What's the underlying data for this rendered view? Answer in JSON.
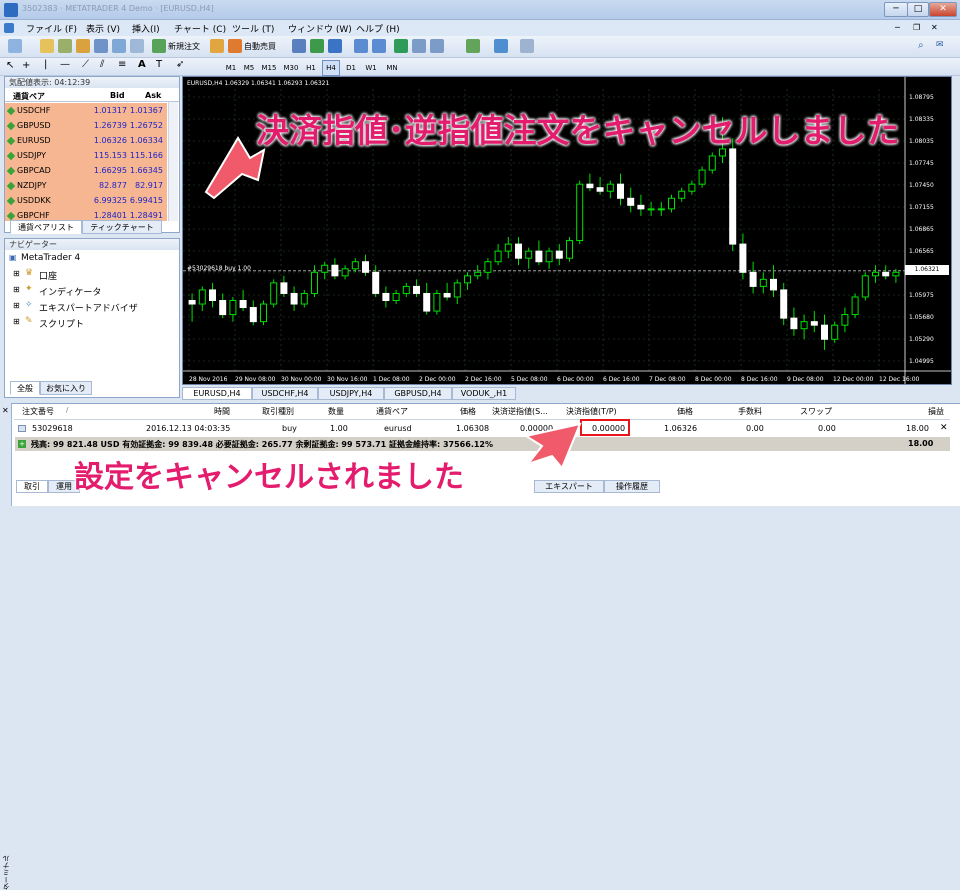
{
  "window": {
    "title": "3502383 · METATRADER 4 Demo · [EURUSD,H4]",
    "minimize": "─",
    "maximize": "□",
    "close": "✕"
  },
  "menu": [
    "ファイル (F)",
    "表示 (V)",
    "挿入(I)",
    "チャート (C)",
    "ツール (T)",
    "ウィンドウ (W)",
    "ヘルプ (H)"
  ],
  "toolbar": {
    "new_order": "新規注文",
    "auto_trade": "自動売買",
    "timeframes": [
      "M1",
      "M5",
      "M15",
      "M30",
      "H1",
      "H4",
      "D1",
      "W1",
      "MN"
    ],
    "active_tf": "H4"
  },
  "market_watch": {
    "title": "気配値表示: 04:12:39",
    "col_symbol": "通貨ペア",
    "col_bid": "Bid",
    "col_ask": "Ask",
    "rows": [
      {
        "symbol": "USDCHF",
        "bid": "1.01317",
        "ask": "1.01367"
      },
      {
        "symbol": "GBPUSD",
        "bid": "1.26739",
        "ask": "1.26752"
      },
      {
        "symbol": "EURUSD",
        "bid": "1.06326",
        "ask": "1.06334"
      },
      {
        "symbol": "USDJPY",
        "bid": "115.153",
        "ask": "115.166"
      },
      {
        "symbol": "GBPCAD",
        "bid": "1.66295",
        "ask": "1.66345"
      },
      {
        "symbol": "NZDJPY",
        "bid": "82.877",
        "ask": "82.917"
      },
      {
        "symbol": "USDDKK",
        "bid": "6.99325",
        "ask": "6.99415"
      },
      {
        "symbol": "GBPCHF",
        "bid": "1.28401",
        "ask": "1.28491"
      }
    ],
    "tabs": [
      "通貨ペアリスト",
      "ティックチャート"
    ]
  },
  "navigator": {
    "title": "ナビゲーター",
    "root": "MetaTrader 4",
    "items": [
      "口座",
      "インディケータ",
      "エキスパートアドバイザ",
      "スクリプト"
    ],
    "tabs": [
      "全般",
      "お気に入り"
    ]
  },
  "chart": {
    "header": "EURUSD,H4  1.06329 1.06341 1.06293 1.06321",
    "order_label": "#53029618 buy 1.00",
    "price_tag": "1.06321",
    "tabs": [
      "EURUSD,H4",
      "USDCHF,H4",
      "USDJPY,H4",
      "GBPUSD,H4",
      "VODUK_,H1"
    ],
    "active_tab": "EURUSD,H4"
  },
  "chart_data": {
    "type": "candlestick",
    "title": "",
    "y_ticks": [
      "1.08795",
      "1.08335",
      "1.08035",
      "1.07745",
      "1.07450",
      "1.07155",
      "1.06865",
      "1.06565",
      "1.06321",
      "1.05975",
      "1.05680",
      "1.05290",
      "1.04995"
    ],
    "x_ticks": [
      "28 Nov 2016",
      "29 Nov 08:00",
      "30 Nov 00:00",
      "30 Nov 16:00",
      "1 Dec 08:00",
      "2 Dec 00:00",
      "2 Dec 16:00",
      "5 Dec 08:00",
      "6 Dec 00:00",
      "6 Dec 16:00",
      "7 Dec 08:00",
      "8 Dec 00:00",
      "8 Dec 16:00",
      "9 Dec 08:00",
      "12 Dec 00:00",
      "12 Dec 16:00"
    ],
    "ylim": [
      1.049,
      1.089
    ],
    "candles": [
      [
        1.059,
        1.06,
        1.056,
        1.0585
      ],
      [
        1.0585,
        1.061,
        1.0575,
        1.0605
      ],
      [
        1.0605,
        1.0615,
        1.058,
        1.059
      ],
      [
        1.059,
        1.06,
        1.0565,
        1.057
      ],
      [
        1.057,
        1.0595,
        1.056,
        1.059
      ],
      [
        1.059,
        1.0605,
        1.0575,
        1.058
      ],
      [
        1.058,
        1.059,
        1.0555,
        1.056
      ],
      [
        1.056,
        1.059,
        1.0555,
        1.0585
      ],
      [
        1.0585,
        1.062,
        1.058,
        1.0615
      ],
      [
        1.0615,
        1.0625,
        1.0595,
        1.06
      ],
      [
        1.06,
        1.061,
        1.0575,
        1.0585
      ],
      [
        1.0585,
        1.0605,
        1.058,
        1.06
      ],
      [
        1.06,
        1.064,
        1.0595,
        1.063
      ],
      [
        1.063,
        1.0645,
        1.062,
        1.064
      ],
      [
        1.064,
        1.065,
        1.062,
        1.0625
      ],
      [
        1.0625,
        1.064,
        1.062,
        1.0635
      ],
      [
        1.0635,
        1.065,
        1.063,
        1.0645
      ],
      [
        1.0645,
        1.0655,
        1.0625,
        1.063
      ],
      [
        1.063,
        1.064,
        1.0595,
        1.06
      ],
      [
        1.06,
        1.061,
        1.058,
        1.059
      ],
      [
        1.059,
        1.0605,
        1.0585,
        1.06
      ],
      [
        1.06,
        1.0615,
        1.0595,
        1.061
      ],
      [
        1.061,
        1.062,
        1.0595,
        1.06
      ],
      [
        1.06,
        1.0615,
        1.057,
        1.0575
      ],
      [
        1.0575,
        1.0605,
        1.057,
        1.06
      ],
      [
        1.06,
        1.0615,
        1.059,
        1.0595
      ],
      [
        1.0595,
        1.062,
        1.0585,
        1.0615
      ],
      [
        1.0615,
        1.063,
        1.0605,
        1.0625
      ],
      [
        1.0625,
        1.064,
        1.062,
        1.063
      ],
      [
        1.063,
        1.065,
        1.062,
        1.0645
      ],
      [
        1.0645,
        1.067,
        1.064,
        1.066
      ],
      [
        1.066,
        1.068,
        1.065,
        1.067
      ],
      [
        1.067,
        1.068,
        1.064,
        1.065
      ],
      [
        1.065,
        1.0665,
        1.0635,
        1.066
      ],
      [
        1.066,
        1.0675,
        1.064,
        1.0645
      ],
      [
        1.0645,
        1.0665,
        1.0635,
        1.066
      ],
      [
        1.066,
        1.067,
        1.064,
        1.065
      ],
      [
        1.065,
        1.068,
        1.0645,
        1.0675
      ],
      [
        1.0675,
        1.076,
        1.067,
        1.0755
      ],
      [
        1.0755,
        1.077,
        1.0745,
        1.075
      ],
      [
        1.075,
        1.0765,
        1.074,
        1.0745
      ],
      [
        1.0745,
        1.076,
        1.0735,
        1.0755
      ],
      [
        1.0755,
        1.077,
        1.0725,
        1.0735
      ],
      [
        1.0735,
        1.075,
        1.0715,
        1.0725
      ],
      [
        1.0725,
        1.074,
        1.071,
        1.072
      ],
      [
        1.072,
        1.073,
        1.071,
        1.072
      ],
      [
        1.072,
        1.073,
        1.071,
        1.072
      ],
      [
        1.072,
        1.074,
        1.0715,
        1.0735
      ],
      [
        1.0735,
        1.075,
        1.073,
        1.0745
      ],
      [
        1.0745,
        1.076,
        1.074,
        1.0755
      ],
      [
        1.0755,
        1.078,
        1.075,
        1.0775
      ],
      [
        1.0775,
        1.08,
        1.077,
        1.0795
      ],
      [
        1.0795,
        1.085,
        1.0785,
        1.0805
      ],
      [
        1.0805,
        1.082,
        1.066,
        1.067
      ],
      [
        1.067,
        1.0685,
        1.062,
        1.063
      ],
      [
        1.063,
        1.0645,
        1.06,
        1.061
      ],
      [
        1.061,
        1.063,
        1.06,
        1.062
      ],
      [
        1.062,
        1.064,
        1.0595,
        1.0605
      ],
      [
        1.0605,
        1.0615,
        1.0555,
        1.0565
      ],
      [
        1.0565,
        1.058,
        1.054,
        1.055
      ],
      [
        1.055,
        1.057,
        1.0535,
        1.056
      ],
      [
        1.056,
        1.0575,
        1.0545,
        1.0555
      ],
      [
        1.0555,
        1.057,
        1.052,
        1.0535
      ],
      [
        1.0535,
        1.056,
        1.053,
        1.0555
      ],
      [
        1.0555,
        1.058,
        1.0545,
        1.057
      ],
      [
        1.057,
        1.06,
        1.0565,
        1.0595
      ],
      [
        1.0595,
        1.063,
        1.059,
        1.0625
      ],
      [
        1.0625,
        1.064,
        1.0615,
        1.063
      ],
      [
        1.063,
        1.064,
        1.062,
        1.0625
      ],
      [
        1.0625,
        1.0635,
        1.0615,
        1.063
      ]
    ]
  },
  "terminal": {
    "side_label": "ターミナル",
    "headers": {
      "order": "注文番号",
      "time": "時間",
      "type": "取引種別",
      "size": "数量",
      "symbol": "通貨ペア",
      "price": "価格",
      "sl": "決済逆指値(S...",
      "tp": "決済指値(T/P)",
      "cur_price": "価格",
      "commission": "手数料",
      "swap": "スワップ",
      "profit": "損益"
    },
    "row": {
      "order": "53029618",
      "time": "2016.12.13 04:03:35",
      "type": "buy",
      "size": "1.00",
      "symbol": "eurusd",
      "price": "1.06308",
      "sl": "0.00000",
      "tp": "0.00000",
      "cur_price": "1.06326",
      "commission": "0.00",
      "swap": "0.00",
      "profit": "18.00"
    },
    "summary": "残高: 99 821.48 USD  有効証拠金: 99 839.48  必要証拠金: 265.77  余剰証拠金: 99 573.71  証拠金維持率: 37566.12%",
    "summary_profit": "18.00",
    "tabs": [
      "取引",
      "運用",
      "エキスパート",
      "操作履歴"
    ]
  },
  "callouts": {
    "top": "決済指値･逆指値注文をキャンセルしました",
    "bottom": "設定をキャンセルされました",
    "color": "#e31c6e"
  }
}
